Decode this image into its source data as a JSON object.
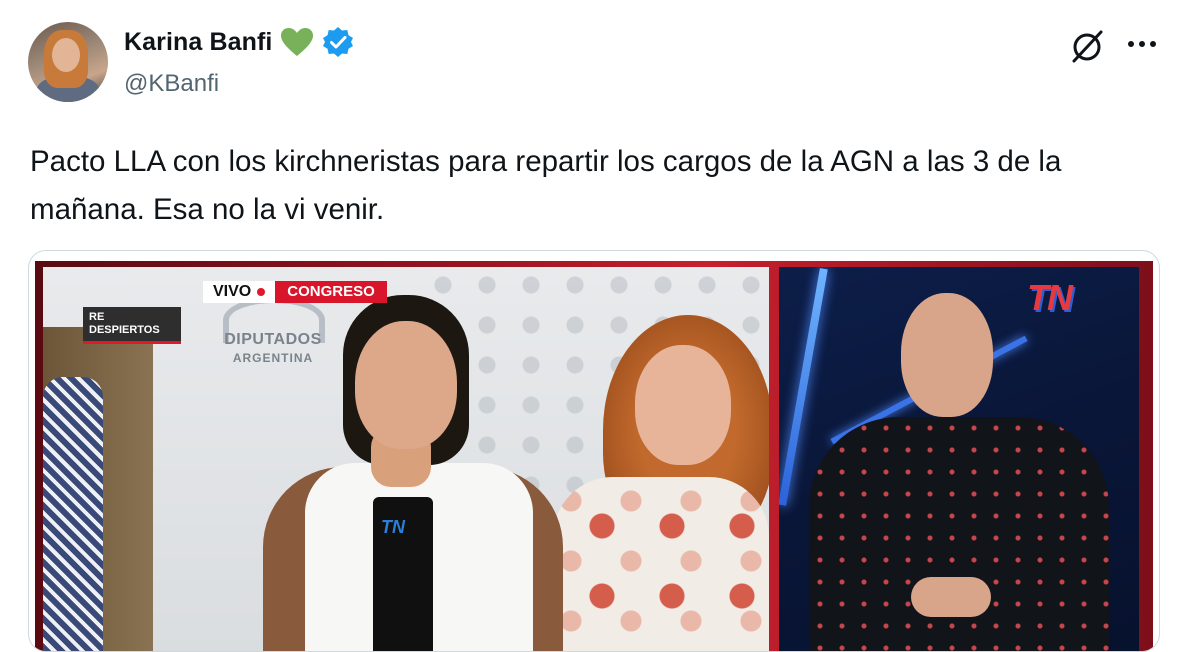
{
  "author": {
    "display_name": "Karina Banfi",
    "handle": "@KBanfi",
    "avatar_icon": "profile-photo",
    "badge_icons": [
      "green-heart-icon",
      "verified-badge-icon"
    ],
    "verified_color": "#1d9bf0"
  },
  "actions": {
    "grok_icon": "grok-icon",
    "more_icon": "more-icon"
  },
  "tweet": {
    "text": "Pacto LLA con los kirchneristas para repartir los cargos de la AGN a las 3 de la mañana. Esa no la vi venir."
  },
  "media": {
    "left_overlay": {
      "live_label": "VIVO",
      "location_label": "CONGRESO",
      "show_tag": "RE DESPIERTOS",
      "backdrop_text_line1": "DIPUTADOS",
      "backdrop_text_line2": "ARGENTINA",
      "mic_label": "TN"
    },
    "right_overlay": {
      "channel_logo": "TN"
    }
  }
}
